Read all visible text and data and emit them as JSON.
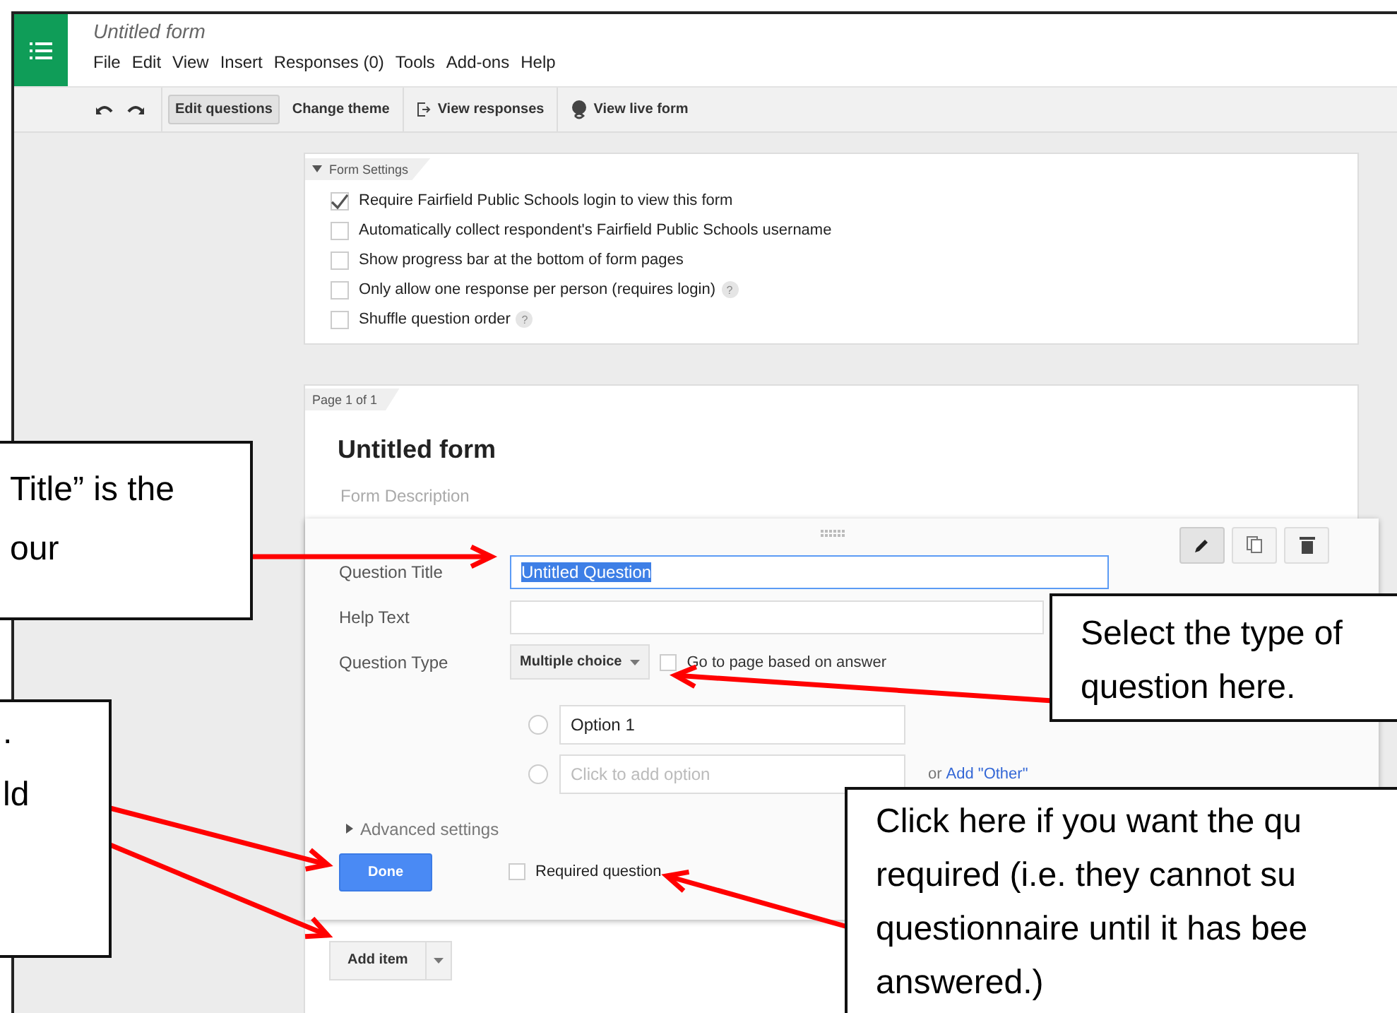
{
  "app": {
    "title": "Untitled form",
    "menu": [
      "File",
      "Edit",
      "View",
      "Insert",
      "Responses (0)",
      "Tools",
      "Add-ons",
      "Help"
    ]
  },
  "toolbar": {
    "buttons": [
      {
        "label": "Edit questions",
        "kind": "plain",
        "selected": true
      },
      {
        "label": "Change theme",
        "kind": "plain",
        "selected": false
      },
      {
        "label": "View responses",
        "kind": "responses",
        "selected": false
      },
      {
        "label": "View live form",
        "kind": "live",
        "selected": false
      }
    ]
  },
  "form_settings": {
    "label": "Form Settings",
    "expanded": true,
    "options": [
      {
        "label": "Require Fairfield Public Schools login to view this form",
        "checked": true
      },
      {
        "label": "Automatically collect respondent's Fairfield Public Schools username",
        "checked": false
      },
      {
        "label": "Show progress bar at the bottom of form pages",
        "checked": false
      },
      {
        "label": "Only allow one response per person (requires login)",
        "checked": false,
        "help": "?"
      },
      {
        "label": "Shuffle question order",
        "checked": false,
        "help": "?"
      }
    ]
  },
  "page": {
    "label": "Page 1 of 1",
    "title": "Untitled form",
    "description_placeholder": "Form Description"
  },
  "question": {
    "actions": [
      {
        "kind": "edit",
        "selected": true
      },
      {
        "kind": "duplicate",
        "selected": false
      },
      {
        "kind": "delete",
        "selected": false
      }
    ],
    "title_label": "Question Title",
    "title_value": "Untitled Question",
    "title_selected": true,
    "help_label": "Help Text",
    "type_label": "Question Type",
    "type_value": "Multiple choice",
    "go_to_page": {
      "label": "Go to page based on answer",
      "checked": false
    },
    "options": [
      {
        "value": "Option 1",
        "selected": false
      }
    ],
    "add_option": {
      "placeholder": "Click to add option",
      "selected": false
    },
    "or_text": "or",
    "add_other": "Add \"Other\"",
    "advanced": "Advanced settings",
    "advanced_expanded": false,
    "done": "Done",
    "required": {
      "label": "Required question",
      "checked": false
    }
  },
  "add_item": "Add item",
  "callouts": [
    {
      "lines": [
        "Title” is the",
        "our"
      ]
    },
    {
      "lines": [
        ".",
        "ld"
      ]
    },
    {
      "lines": [
        "Select the type of",
        "question here."
      ]
    },
    {
      "lines": [
        "Click here if you want the qu",
        "required (i.e. they cannot su",
        "questionnaire until it has bee",
        "answered.)"
      ]
    }
  ]
}
